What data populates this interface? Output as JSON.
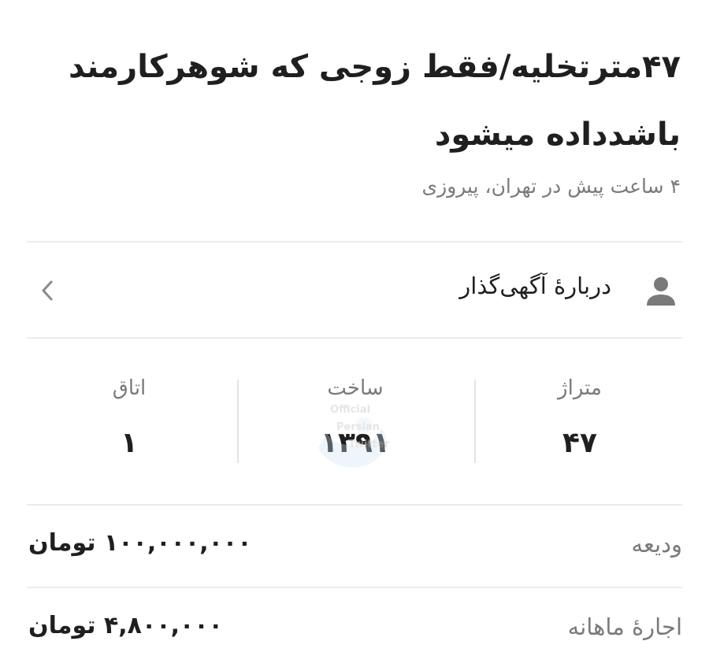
{
  "listing": {
    "title_line1": "۴۷مترتخلیه/فقط زوجی که شوهرکارمند",
    "title_line2": "باشدداده میشود",
    "meta": "۴ ساعت پیش در تهران، پیروزی"
  },
  "advertiser": {
    "label": "دربارهٔ آگهی‌گذار",
    "icon": "person-icon",
    "chevron_icon": "chevron-left-icon"
  },
  "stats": {
    "area_label": "متراژ",
    "area_value": "۴۷",
    "build_label": "ساخت",
    "build_value": "۱۳۹۱",
    "rooms_label": "اتاق",
    "rooms_value": "۱"
  },
  "watermark": {
    "line1": "Official",
    "line2": "Persian",
    "line3": "Twitter"
  },
  "prices": {
    "deposit_label": "ودیعه",
    "deposit_value": "۱۰۰,۰۰۰,۰۰۰ تومان",
    "rent_label": "اجارهٔ ماهانه",
    "rent_value": "۴,۸۰۰,۰۰۰ تومان"
  },
  "colors": {
    "text": "#1f1f1f",
    "muted": "#7a7a7a",
    "divider": "#ececec"
  }
}
